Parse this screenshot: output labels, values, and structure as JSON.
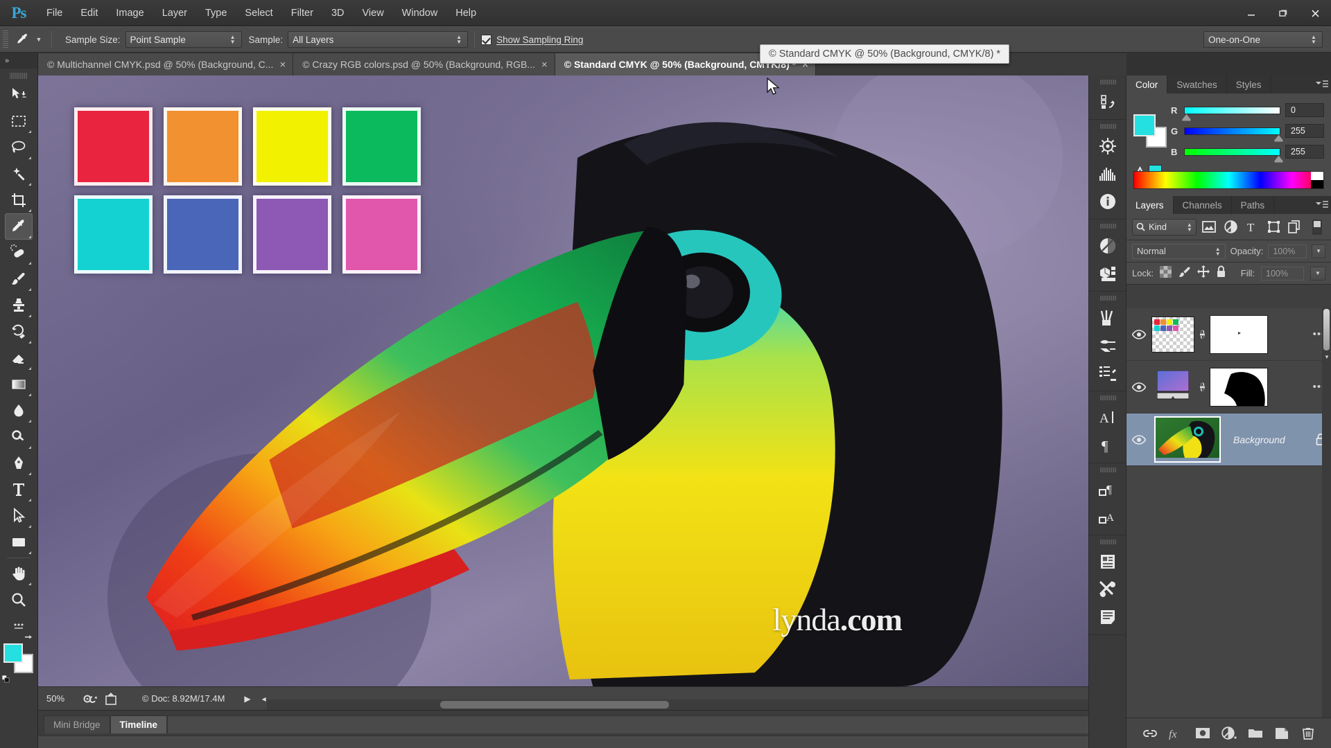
{
  "app": {
    "name": "Photoshop",
    "logo": "Ps"
  },
  "menubar": {
    "items": [
      "File",
      "Edit",
      "Image",
      "Layer",
      "Type",
      "Select",
      "Filter",
      "3D",
      "View",
      "Window",
      "Help"
    ]
  },
  "window_controls": {
    "minimize": "minimize-icon",
    "restore": "restore-icon",
    "close": "close-icon"
  },
  "options_bar": {
    "tool_icon": "eyedropper-icon",
    "sample_size": {
      "label": "Sample Size:",
      "value": "Point Sample"
    },
    "sample": {
      "label": "Sample:",
      "value": "All Layers"
    },
    "show_sampling_ring": {
      "label": "Show Sampling Ring",
      "checked": true
    },
    "workspace": {
      "value": "One-on-One"
    }
  },
  "floating_tab": {
    "label": "© Standard CMYK @ 50% (Background, CMYK/8) *"
  },
  "document_tabs": [
    {
      "label": "© Multichannel CMYK.psd @ 50% (Background, C...",
      "active": false,
      "close": "×"
    },
    {
      "label": "© Crazy RGB colors.psd @ 50% (Background, RGB...",
      "active": false,
      "close": "×"
    },
    {
      "label": "© Standard CMYK @ 50% (Background, CMYK/8) *",
      "active": true,
      "close": "×"
    }
  ],
  "toolbar": {
    "expand_label": "»",
    "tools": [
      {
        "name": "move-tool",
        "icon": "move-icon",
        "selected": false,
        "has_flyout": false
      },
      {
        "name": "rectangular-marquee-tool",
        "icon": "marquee-icon",
        "selected": false,
        "has_flyout": true
      },
      {
        "name": "lasso-tool",
        "icon": "lasso-icon",
        "selected": false,
        "has_flyout": true
      },
      {
        "name": "magic-wand-tool",
        "icon": "magic-wand-icon",
        "selected": false,
        "has_flyout": true
      },
      {
        "name": "crop-tool",
        "icon": "crop-icon",
        "selected": false,
        "has_flyout": true
      },
      {
        "name": "eyedropper-tool",
        "icon": "eyedropper-icon",
        "selected": true,
        "has_flyout": true
      },
      {
        "name": "healing-brush-tool",
        "icon": "healing-brush-icon",
        "selected": false,
        "has_flyout": true
      },
      {
        "name": "brush-tool",
        "icon": "brush-icon",
        "selected": false,
        "has_flyout": true
      },
      {
        "name": "clone-stamp-tool",
        "icon": "clone-stamp-icon",
        "selected": false,
        "has_flyout": true
      },
      {
        "name": "history-brush-tool",
        "icon": "history-brush-icon",
        "selected": false,
        "has_flyout": true
      },
      {
        "name": "eraser-tool",
        "icon": "eraser-icon",
        "selected": false,
        "has_flyout": true
      },
      {
        "name": "gradient-tool",
        "icon": "gradient-icon",
        "selected": false,
        "has_flyout": true
      },
      {
        "name": "blur-tool",
        "icon": "blur-icon",
        "selected": false,
        "has_flyout": true
      },
      {
        "name": "dodge-tool",
        "icon": "dodge-icon",
        "selected": false,
        "has_flyout": true
      },
      {
        "name": "pen-tool",
        "icon": "pen-icon",
        "selected": false,
        "has_flyout": true
      },
      {
        "name": "type-tool",
        "icon": "type-icon",
        "selected": false,
        "has_flyout": true
      },
      {
        "name": "path-selection-tool",
        "icon": "path-selection-icon",
        "selected": false,
        "has_flyout": true
      },
      {
        "name": "rectangle-tool",
        "icon": "rectangle-icon",
        "selected": false,
        "has_flyout": true
      },
      {
        "name": "hand-tool",
        "icon": "hand-icon",
        "selected": false,
        "has_flyout": true
      },
      {
        "name": "zoom-tool",
        "icon": "zoom-icon",
        "selected": false,
        "has_flyout": false
      },
      {
        "name": "edit-toolbar",
        "icon": "ellipsis-icon",
        "selected": false,
        "has_flyout": false
      }
    ],
    "foreground_color": "#24e0e0",
    "background_color": "#ffffff"
  },
  "canvas": {
    "swatches": [
      {
        "name": "swatch-red",
        "color": "#e8243f"
      },
      {
        "name": "swatch-orange",
        "color": "#f2912f"
      },
      {
        "name": "swatch-yellow",
        "color": "#f2f200"
      },
      {
        "name": "swatch-green",
        "color": "#0cba5e"
      },
      {
        "name": "swatch-cyan",
        "color": "#14d2d2"
      },
      {
        "name": "swatch-blue",
        "color": "#4a66b8"
      },
      {
        "name": "swatch-purple",
        "color": "#8e58b5"
      },
      {
        "name": "swatch-pink",
        "color": "#e057ab"
      }
    ],
    "background_color": "#6a6285",
    "subject": "keel-billed-toucan"
  },
  "status_bar": {
    "zoom": "50%",
    "doc": "© Doc: 8.92M/17.4M",
    "play_arrow": "▶",
    "left_arrow": "◂"
  },
  "bottom_panel_tabs": [
    {
      "label": "Mini Bridge",
      "active": false
    },
    {
      "label": "Timeline",
      "active": true
    }
  ],
  "icon_rail": [
    {
      "group": 0,
      "items": [
        {
          "name": "history-panel-icon"
        }
      ]
    },
    {
      "group": 1,
      "items": [
        {
          "name": "navigator-panel-icon"
        },
        {
          "name": "histogram-panel-icon"
        },
        {
          "name": "info-panel-icon"
        }
      ]
    },
    {
      "group": 2,
      "items": [
        {
          "name": "adjustments-panel-icon"
        },
        {
          "name": "3d-panel-icon"
        }
      ]
    },
    {
      "group": 3,
      "items": [
        {
          "name": "brush-presets-panel-icon"
        },
        {
          "name": "tool-presets-panel-icon"
        },
        {
          "name": "brush-panel-icon"
        }
      ]
    },
    {
      "group": 4,
      "items": [
        {
          "name": "character-panel-icon"
        },
        {
          "name": "paragraph-panel-icon"
        }
      ]
    },
    {
      "group": 5,
      "items": [
        {
          "name": "paragraph-styles-panel-icon"
        },
        {
          "name": "character-styles-panel-icon"
        }
      ]
    },
    {
      "group": 6,
      "items": [
        {
          "name": "notes-panel-icon"
        },
        {
          "name": "actions-panel-icon"
        },
        {
          "name": "properties-panel-icon"
        }
      ]
    }
  ],
  "color_panel": {
    "tabs": [
      {
        "label": "Color",
        "active": true
      },
      {
        "label": "Swatches",
        "active": false
      },
      {
        "label": "Styles",
        "active": false
      }
    ],
    "menu_icon": "panel-menu-icon",
    "foreground": "#24e0e0",
    "background": "#ffffff",
    "channels": [
      {
        "label": "R",
        "value": "0",
        "knob_pct": 0
      },
      {
        "label": "G",
        "value": "255",
        "knob_pct": 100
      },
      {
        "label": "B",
        "value": "255",
        "knob_pct": 100
      }
    ],
    "out_of_gamut_warning": true
  },
  "layers_panel": {
    "tabs": [
      {
        "label": "Layers",
        "active": true
      },
      {
        "label": "Channels",
        "active": false
      },
      {
        "label": "Paths",
        "active": false
      }
    ],
    "menu_icon": "panel-menu-icon",
    "filter": {
      "kind_label": "Kind",
      "search_icon": "search-icon",
      "filter_icons": [
        "pixel-layer-filter-icon",
        "adjustment-layer-filter-icon",
        "type-layer-filter-icon",
        "shape-layer-filter-icon",
        "smart-object-filter-icon"
      ],
      "toggle_icon": "filter-toggle-icon"
    },
    "blend_mode": "Normal",
    "opacity": {
      "label": "Opacity:",
      "value": "100%"
    },
    "fill": {
      "label": "Fill:",
      "value": "100%"
    },
    "lock": {
      "label": "Lock:",
      "icons": [
        "lock-transparent-pixels-icon",
        "lock-image-pixels-icon",
        "lock-position-icon",
        "lock-all-icon"
      ]
    },
    "layers": [
      {
        "name": "layer-row-swatches",
        "label": "",
        "visible": true,
        "selected": false,
        "thumb_type": "transparent-swatches",
        "linked": true,
        "mask_type": "white-mask",
        "more": "•••"
      },
      {
        "name": "layer-row-gradient",
        "label": "",
        "visible": true,
        "selected": false,
        "thumb_type": "gradient-fill",
        "linked": true,
        "mask_type": "toucan-silhouette-mask",
        "more": "•••"
      },
      {
        "name": "layer-row-background",
        "label": "Background",
        "visible": true,
        "selected": true,
        "thumb_type": "toucan-photo",
        "linked": false,
        "mask_type": null,
        "lock_icon": "lock-icon"
      }
    ],
    "footer_icons": [
      "link-layers-icon",
      "layer-style-fx-icon",
      "add-layer-mask-icon",
      "new-adjustment-layer-icon",
      "new-group-icon",
      "new-layer-icon",
      "delete-layer-icon"
    ]
  },
  "watermark": {
    "prefix": "lynda",
    "suffix": ".com"
  }
}
